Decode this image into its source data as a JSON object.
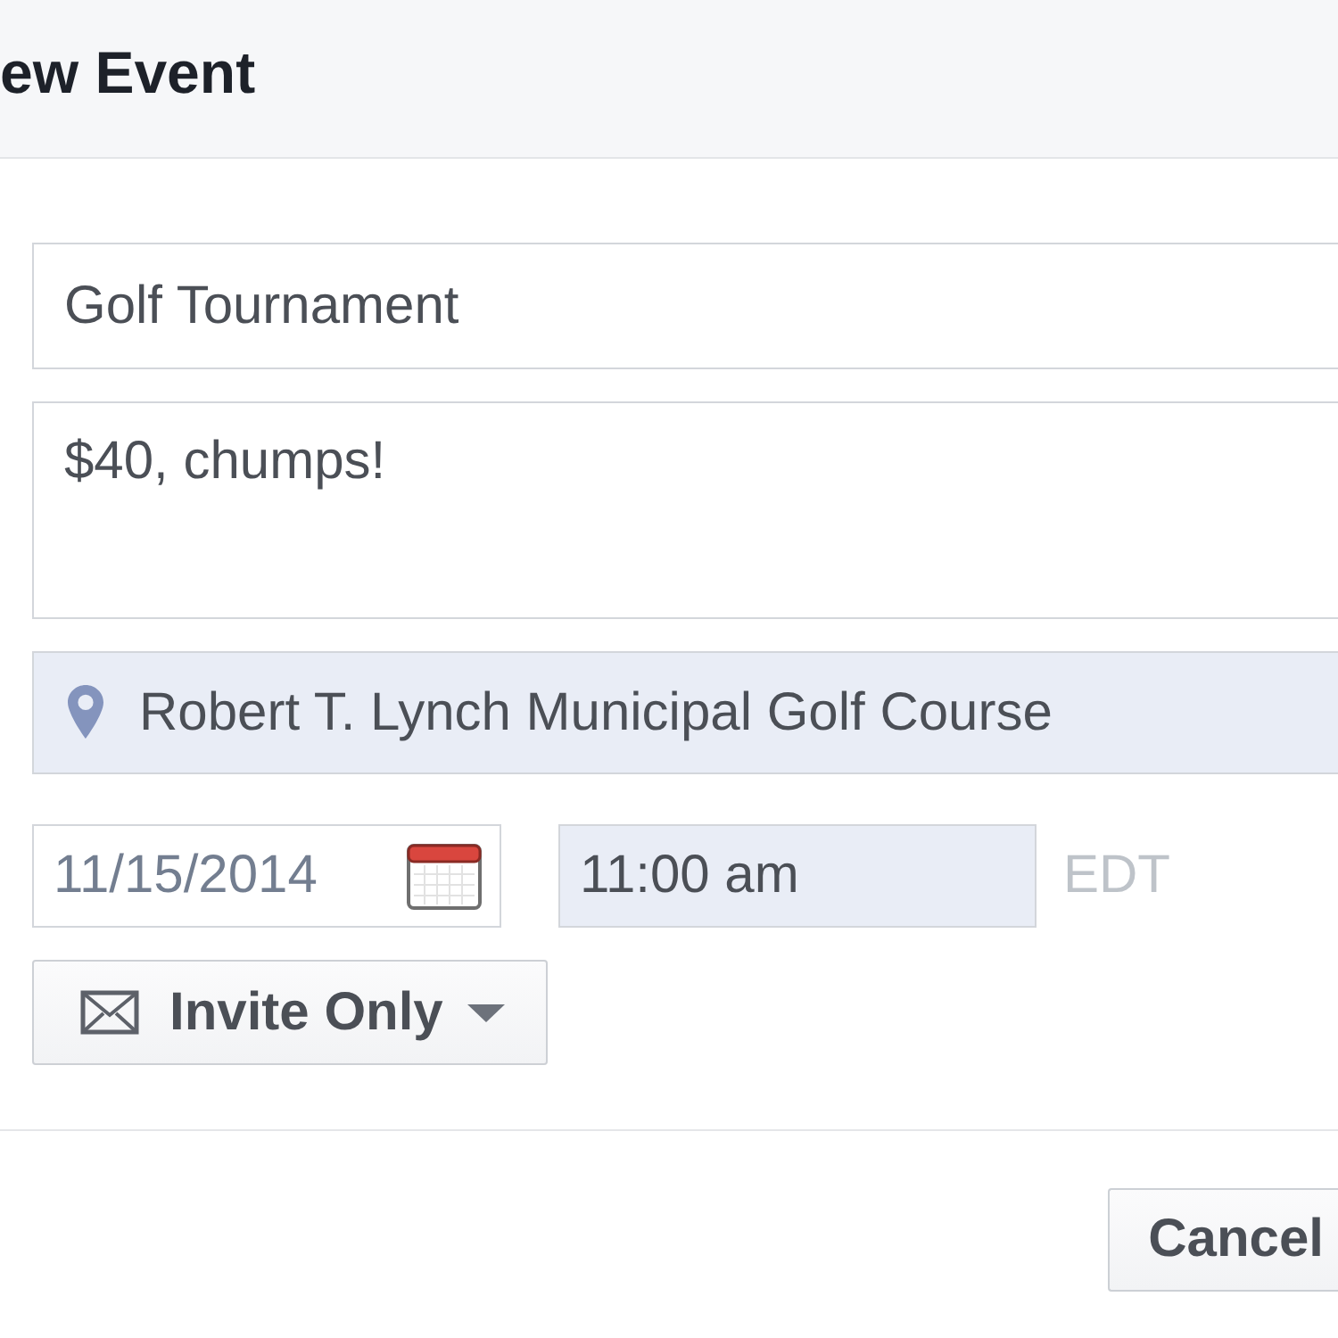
{
  "dialog_header": {
    "title": "ew Event"
  },
  "fields": [
    {
      "kind": "text",
      "value": "Golf Tournament",
      "highlighted": false
    },
    {
      "kind": "textarea",
      "value": "$40, chumps!",
      "highlighted": false
    },
    {
      "kind": "location",
      "value": "Robert T. Lynch Municipal Golf Course",
      "highlighted": true
    }
  ],
  "when": {
    "date": {
      "value": "11/15/2014",
      "highlighted": false
    },
    "time": {
      "value": "11:00 am",
      "highlighted": true
    },
    "timezone": "EDT"
  },
  "privacy_button": {
    "label": "Invite Only"
  },
  "footer_buttons": [
    {
      "label": "Cancel"
    }
  ]
}
